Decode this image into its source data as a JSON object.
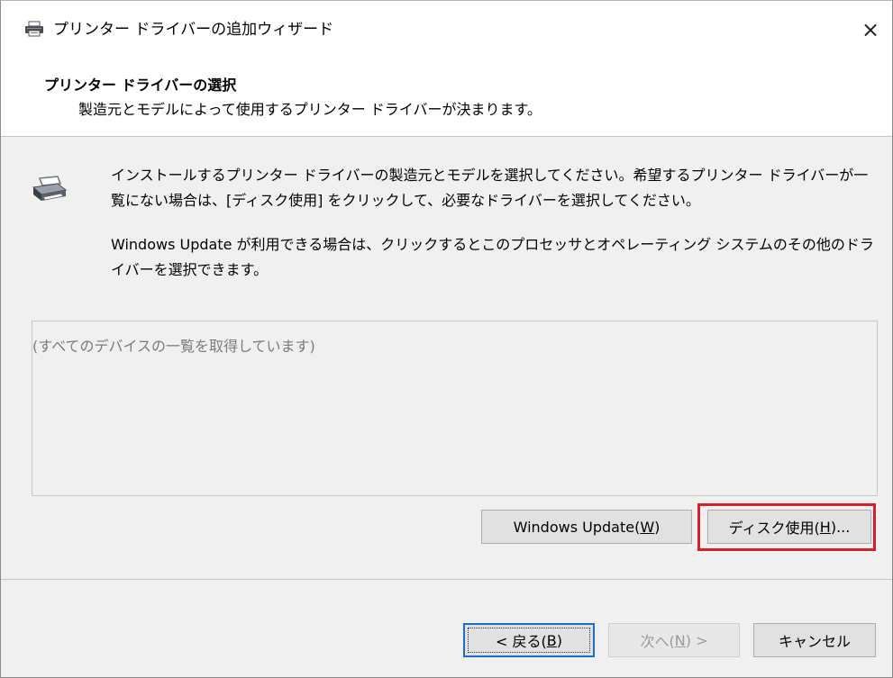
{
  "window": {
    "title": "プリンター ドライバーの追加ウィザード",
    "close_glyph": "×"
  },
  "header": {
    "title": "プリンター ドライバーの選択",
    "subtitle": "製造元とモデルによって使用するプリンター ドライバーが決まります。"
  },
  "content": {
    "paragraph1": "インストールするプリンター ドライバーの製造元とモデルを選択してください。希望するプリンター ドライバーが一覧にない場合は、[ディスク使用] をクリックして、必要なドライバーを選択してください。",
    "paragraph2": "Windows Update が利用できる場合は、クリックするとこのプロセッサとオペレーティング システムのその他のドライバーを選択できます。"
  },
  "device_list": {
    "status_text": "(すべてのデバイスの一覧を取得しています)"
  },
  "buttons": {
    "windows_update": {
      "label": "Windows Update(",
      "accel": "W",
      "suffix": ")"
    },
    "have_disk": {
      "label": "ディスク使用(",
      "accel": "H",
      "suffix": ")..."
    },
    "back": {
      "label": "< 戻る(",
      "accel": "B",
      "suffix": ")"
    },
    "next": {
      "label": "次へ(",
      "accel": "N",
      "suffix": ") >"
    },
    "cancel": {
      "label": "キャンセル"
    }
  },
  "icons": {
    "title_icon": "printer-icon",
    "content_icon": "printer-icon"
  },
  "colors": {
    "highlight": "#d6202a",
    "focus_border": "#1a6fc2"
  }
}
